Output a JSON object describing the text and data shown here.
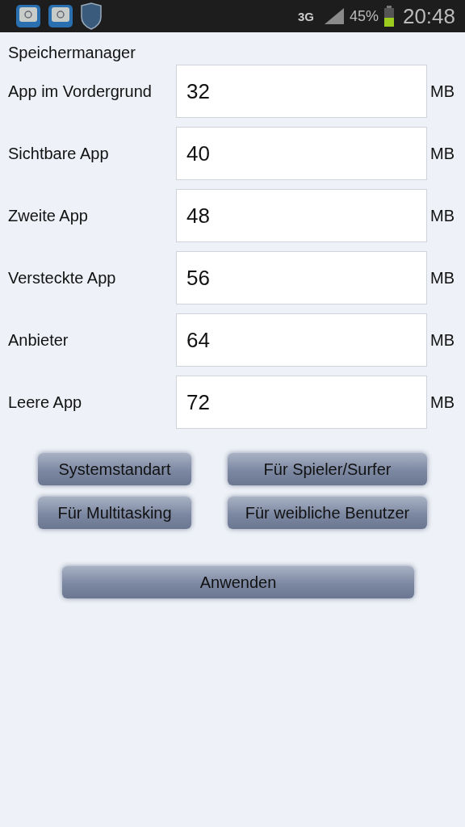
{
  "status_bar": {
    "network": "3G",
    "battery": "45%",
    "time": "20:48"
  },
  "title": "Speichermanager",
  "rows": [
    {
      "label": "App im Vordergrund",
      "value": "32",
      "unit": "MB"
    },
    {
      "label": "Sichtbare App",
      "value": "40",
      "unit": "MB"
    },
    {
      "label": "Zweite App",
      "value": "48",
      "unit": "MB"
    },
    {
      "label": "Versteckte App",
      "value": "56",
      "unit": "MB"
    },
    {
      "label": "Anbieter",
      "value": "64",
      "unit": "MB"
    },
    {
      "label": "Leere App",
      "value": "72",
      "unit": "MB"
    }
  ],
  "presets": [
    "Systemstandart",
    "Für Spieler/Surfer",
    "Für Multitasking",
    "Für weibliche Benutzer"
  ],
  "apply": "Anwenden"
}
